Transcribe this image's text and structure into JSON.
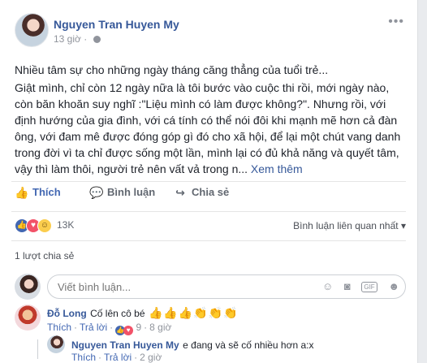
{
  "post": {
    "author": "Nguyen Tran Huyen My",
    "time": "13 giờ",
    "status": "Nhiều tâm sự cho những ngày tháng căng thẳng của tuổi trẻ...",
    "body": "Giật mình, chỉ còn 12 ngày nữa là tôi bước vào cuộc thi rồi, mới ngày nào, còn băn khoăn suy nghĩ :\"Liệu mình có làm được không?\". Nhưng rồi, với định hướng của gia đình, với cá tính có thể nói đôi khi mạnh mẽ hơn cả đàn ông, với đam mê được đóng góp gì đó cho xã hội, để lại một chút vang danh trong đời vì ta chỉ được sống một lần, mình lại có đủ khả năng và quyết tâm, vậy thì làm thôi, người trẻ nên vất vả trong n...",
    "see_more": "Xem thêm"
  },
  "actions": {
    "like": "Thích",
    "comment": "Bình luận",
    "share": "Chia sẻ"
  },
  "reactions": {
    "count": "13K",
    "sort_label": "Bình luận liên quan nhất"
  },
  "shares": "1 lượt chia sẻ",
  "composer": {
    "placeholder": "Viết bình luận..."
  },
  "comments": [
    {
      "name": "Đỗ Long",
      "text": "Cố lên cô bé",
      "like": "Thích",
      "reply": "Trả lời",
      "reaction_count": "9",
      "time": "8 giờ"
    },
    {
      "name": "Nguyen Tran Huyen My",
      "text": "e đang và sẽ cố nhiều hơn a:x",
      "like": "Thích",
      "reply": "Trả lời",
      "time": "2 giờ"
    }
  ],
  "icons": {
    "more": "more-icon",
    "like": "thumbs-up-icon",
    "comment": "comment-icon",
    "share": "share-icon"
  }
}
